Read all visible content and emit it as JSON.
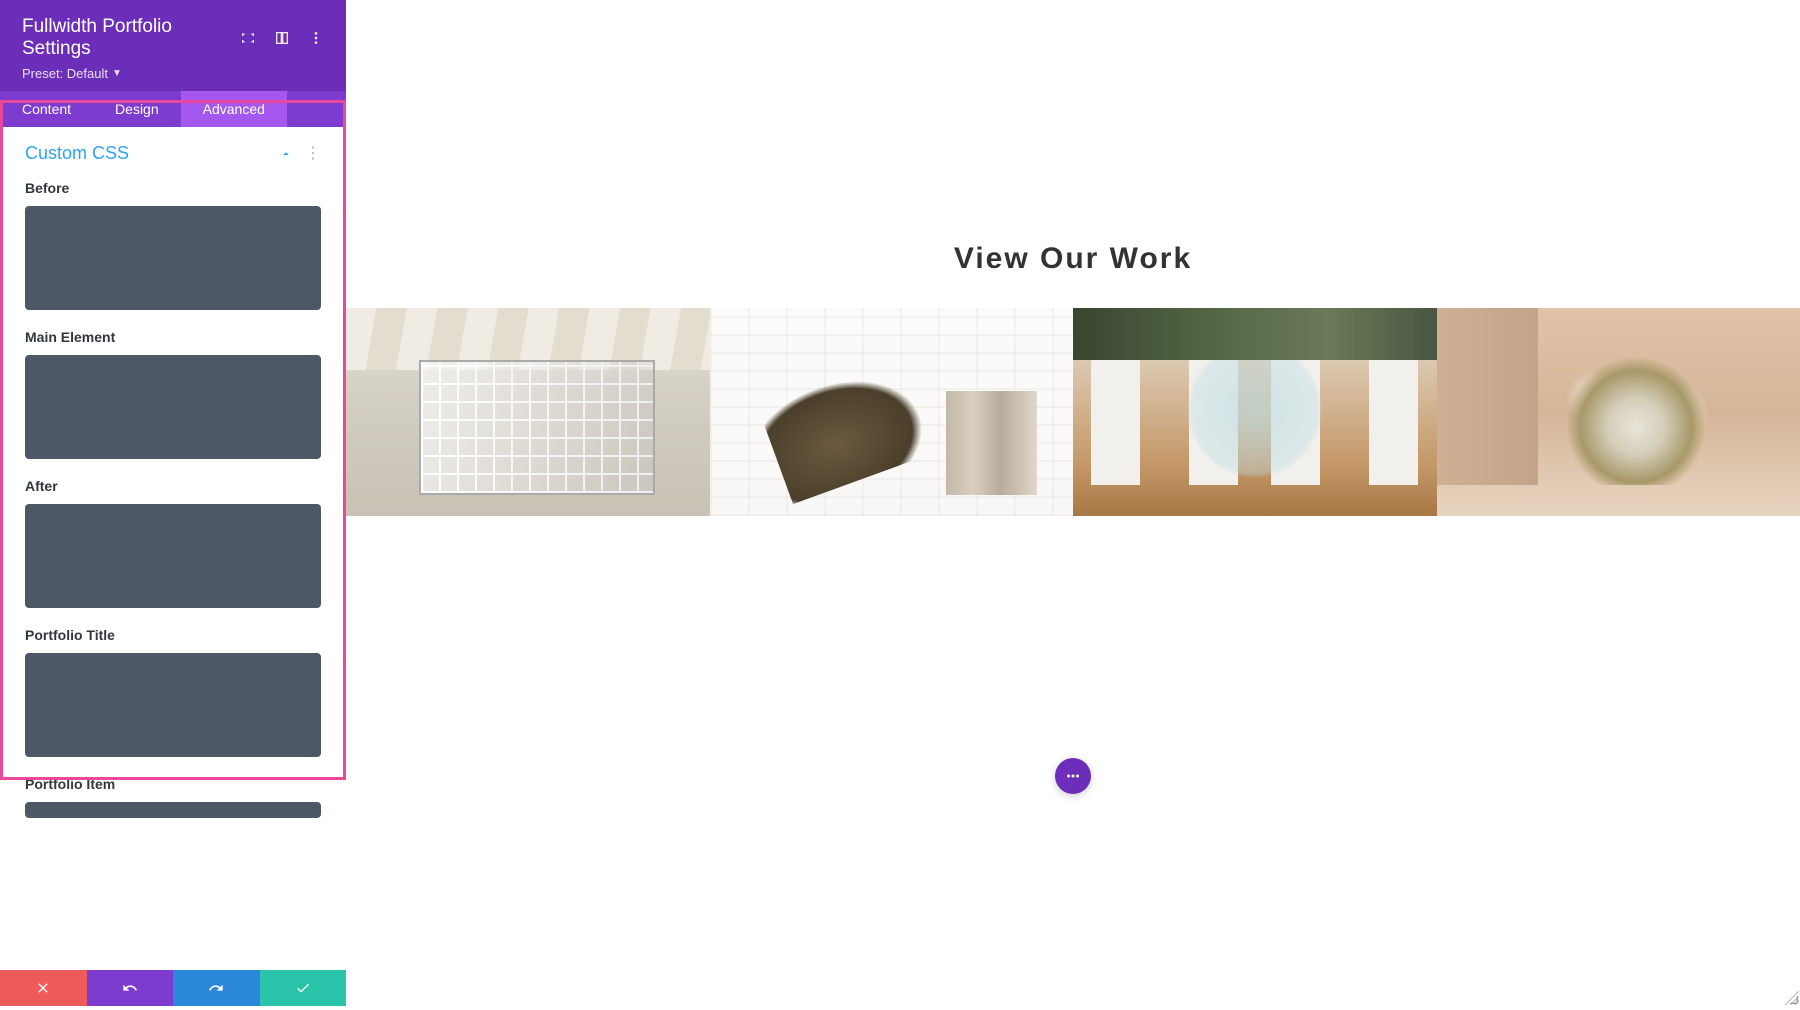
{
  "panel": {
    "title": "Fullwidth Portfolio Settings",
    "preset_label": "Preset: Default",
    "tabs": [
      "Content",
      "Design",
      "Advanced"
    ],
    "active_tab": 2
  },
  "section": {
    "title": "Custom CSS",
    "fields": [
      {
        "label": "Before",
        "value": ""
      },
      {
        "label": "Main Element",
        "value": ""
      },
      {
        "label": "After",
        "value": ""
      },
      {
        "label": "Portfolio Title",
        "value": ""
      },
      {
        "label": "Portfolio Item",
        "value": ""
      }
    ]
  },
  "preview": {
    "heading": "View Our Work"
  },
  "colors": {
    "primary": "#6c2eb9",
    "secondary": "#7e3bd0",
    "active": "#a558ef",
    "link": "#2ea3f2",
    "cancel": "#ef5a5a",
    "save": "#29c4a9",
    "redo": "#2b87da"
  }
}
